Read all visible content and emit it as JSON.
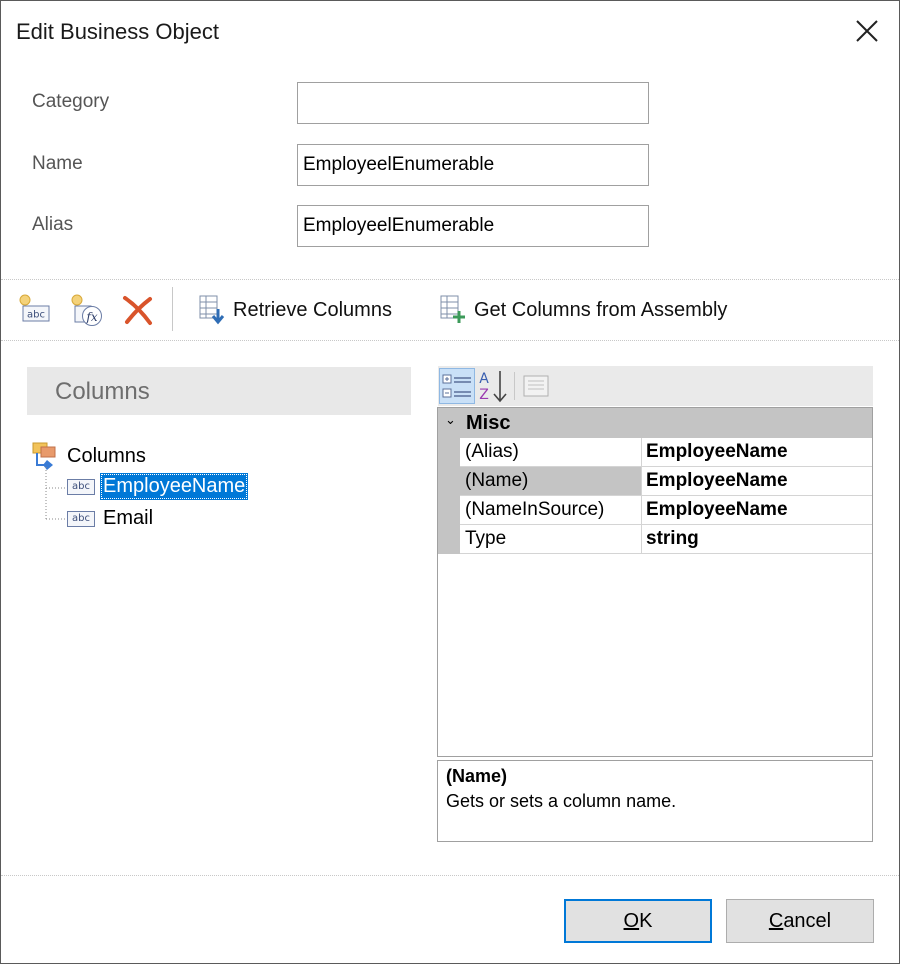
{
  "dialog": {
    "title": "Edit Business Object"
  },
  "form": {
    "category": {
      "label": "Category",
      "value": ""
    },
    "name": {
      "label": "Name",
      "value": "EmployeelEnumerable"
    },
    "alias": {
      "label": "Alias",
      "value": "EmployeelEnumerable"
    }
  },
  "toolbar": {
    "retrieve_columns": "Retrieve Columns",
    "get_columns_from_assembly": "Get Columns from Assembly"
  },
  "columns_panel": {
    "header": "Columns",
    "root_label": "Columns",
    "items": [
      {
        "label": "EmployeeName",
        "selected": true
      },
      {
        "label": "Email",
        "selected": false
      }
    ]
  },
  "property_grid": {
    "category": "Misc",
    "rows": [
      {
        "name": "(Alias)",
        "value": "EmployeeName"
      },
      {
        "name": "(Name)",
        "value": "EmployeeName"
      },
      {
        "name": "(NameInSource)",
        "value": "EmployeeName"
      },
      {
        "name": "Type",
        "value": "string"
      }
    ],
    "description": {
      "title": "(Name)",
      "text": "Gets or sets a column name."
    }
  },
  "buttons": {
    "ok": {
      "underlined": "O",
      "rest": "K"
    },
    "cancel": {
      "underlined": "C",
      "rest": "ancel"
    }
  },
  "colors": {
    "accent": "#0078d7",
    "delete_icon": "#d9542b",
    "grid_gutter": "#c4c4c4"
  }
}
